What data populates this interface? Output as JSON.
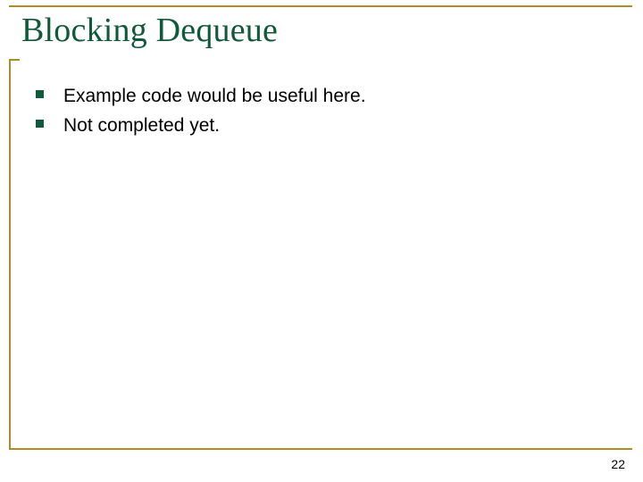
{
  "colors": {
    "accent_rule": "#a98f2a",
    "title_color": "#0f5a3a",
    "bullet_color": "#0f5a3a",
    "text_color": "#000000"
  },
  "slide": {
    "title": "Blocking Dequeue",
    "bullets": [
      "Example code would be useful here.",
      "Not completed yet."
    ],
    "page_number": "22"
  }
}
